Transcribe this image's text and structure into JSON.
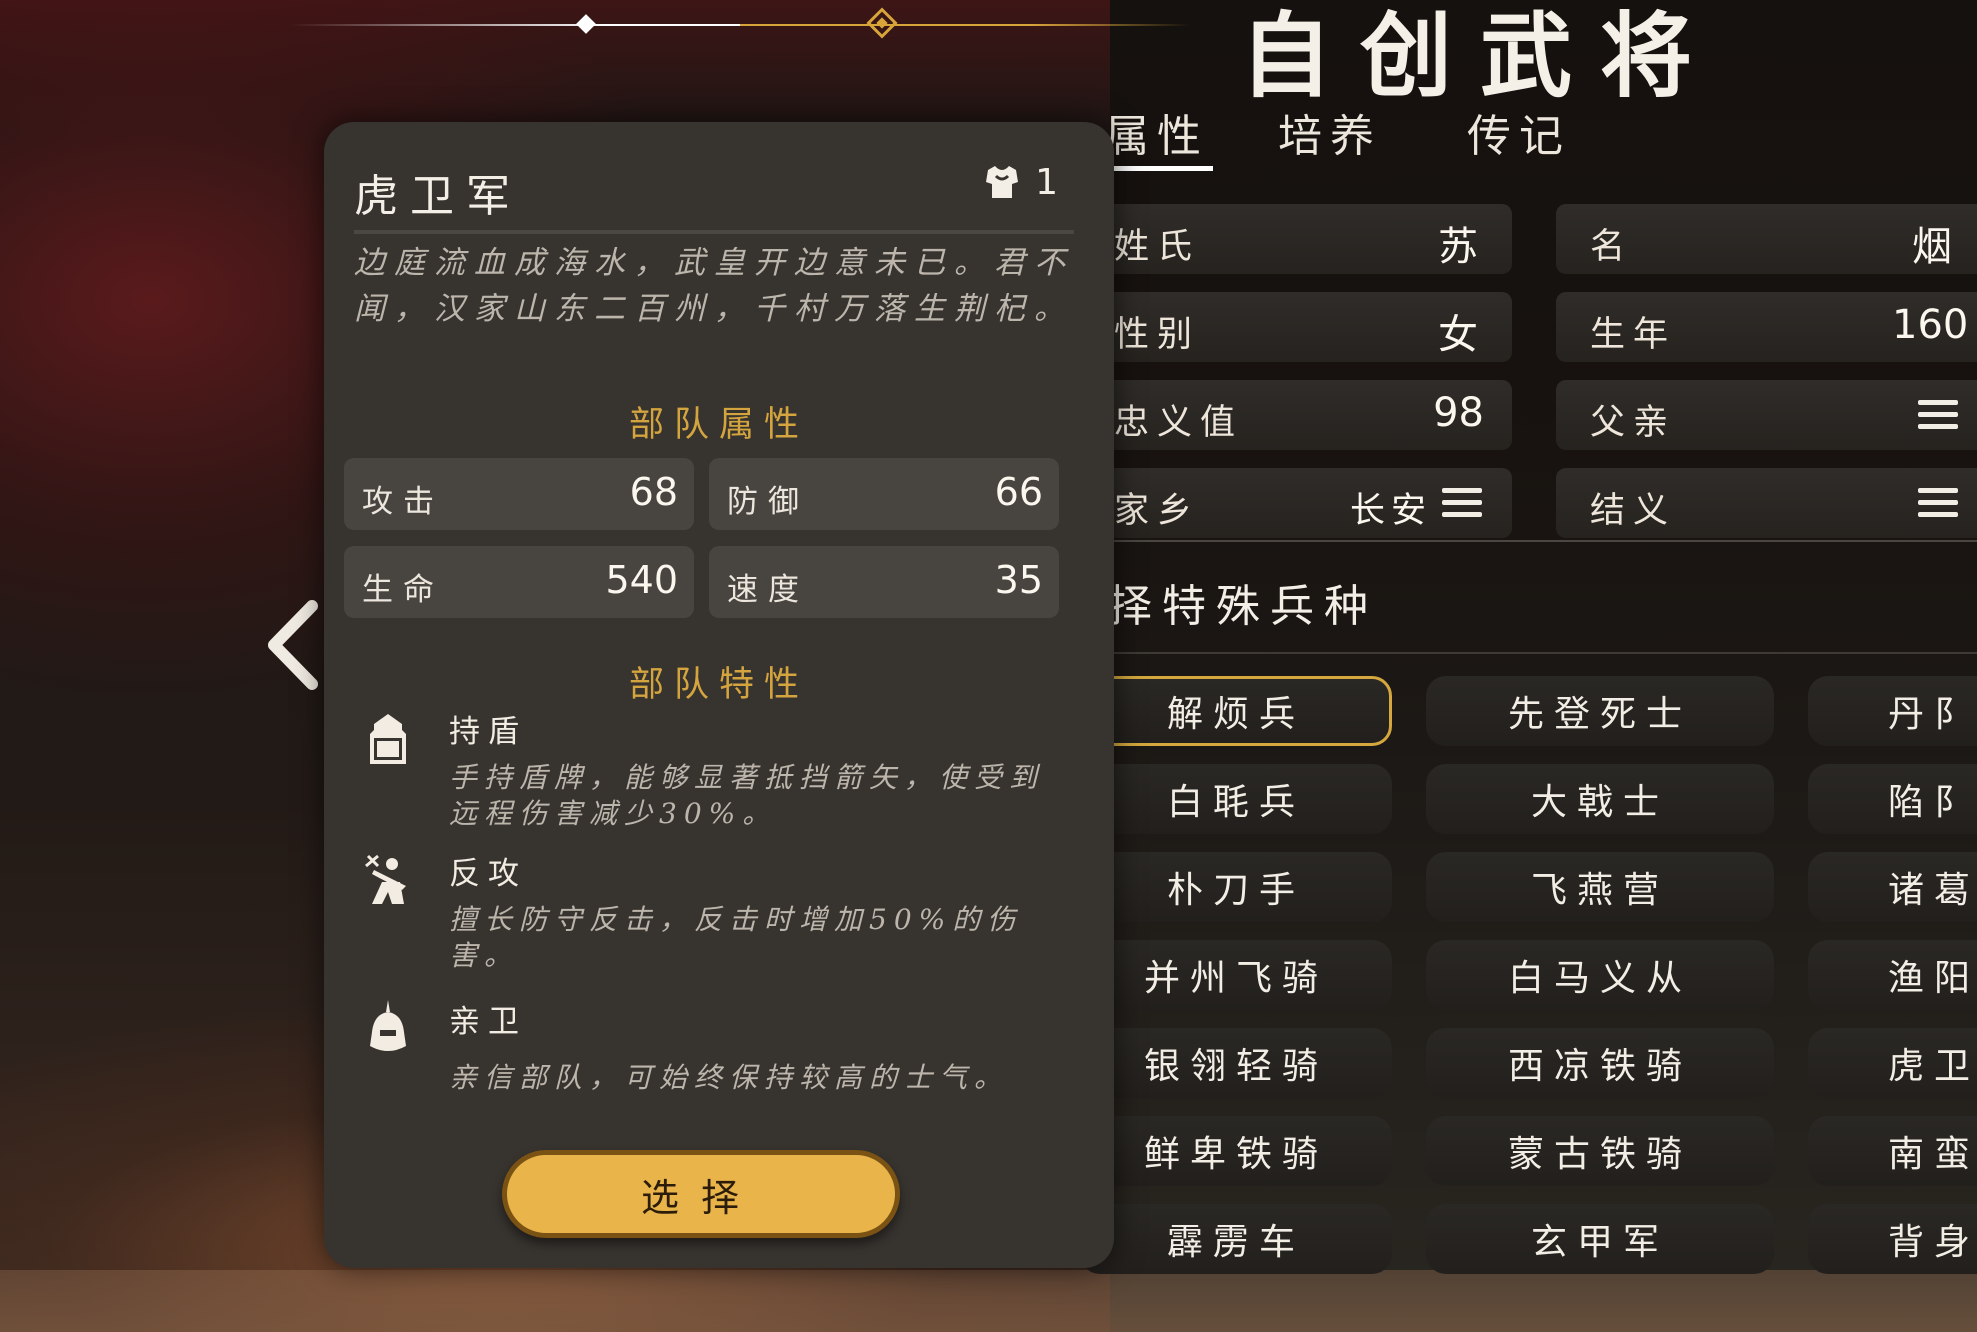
{
  "page": {
    "title": "自创武将",
    "tabs": [
      "属性",
      "培养",
      "传记"
    ],
    "active_tab": 0
  },
  "attributes": {
    "left": [
      {
        "label": "姓氏",
        "value": "苏"
      },
      {
        "label": "性别",
        "value": "女"
      },
      {
        "label": "忠义值",
        "value": "98"
      },
      {
        "label": "家乡",
        "value": "长安"
      }
    ],
    "right": [
      {
        "label": "名",
        "value": "烟"
      },
      {
        "label": "生年",
        "value": "160"
      },
      {
        "label": "父亲",
        "value": ""
      },
      {
        "label": "结义",
        "value": ""
      }
    ]
  },
  "special_units": {
    "heading": "择特殊兵种",
    "columns": [
      [
        "解烦兵",
        "白毦兵",
        "朴刀手",
        "并州飞骑",
        "银翎轻骑",
        "鲜卑铁骑",
        "霹雳车"
      ],
      [
        "先登死士",
        "大戟士",
        "飞燕营",
        "白马义从",
        "西凉铁骑",
        "蒙古铁骑",
        "玄甲军"
      ],
      [
        "丹阝",
        "陷阝",
        "诸葛",
        "渔阳",
        "虎卫",
        "南蛮",
        "背身"
      ]
    ],
    "selected": "解烦兵"
  },
  "unit_detail": {
    "name": "虎卫军",
    "count": "1",
    "poem": "边庭流血成海水，武皇开边意未已。君不闻，汉家山东二百州，千村万落生荆杞。",
    "attr_heading": "部队属性",
    "stats": [
      {
        "label": "攻击",
        "value": "68"
      },
      {
        "label": "防御",
        "value": "66"
      },
      {
        "label": "生命",
        "value": "540"
      },
      {
        "label": "速度",
        "value": "35"
      }
    ],
    "trait_heading": "部队特性",
    "traits": [
      {
        "name": "持盾",
        "icon": "shield-icon",
        "desc": "手持盾牌，能够显著抵挡箭矢，使受到远程伤害减少30%。"
      },
      {
        "name": "反攻",
        "icon": "counterattack-icon",
        "desc": "擅长防守反击，反击时增加50%的伤害。"
      },
      {
        "name": "亲卫",
        "icon": "helmet-icon",
        "desc": "亲信部队，可始终保持较高的士气。"
      }
    ],
    "select_label": "选择"
  },
  "colors": {
    "accent": "#d4a43f",
    "button": "#e9b54a",
    "panel": "#37332f"
  }
}
